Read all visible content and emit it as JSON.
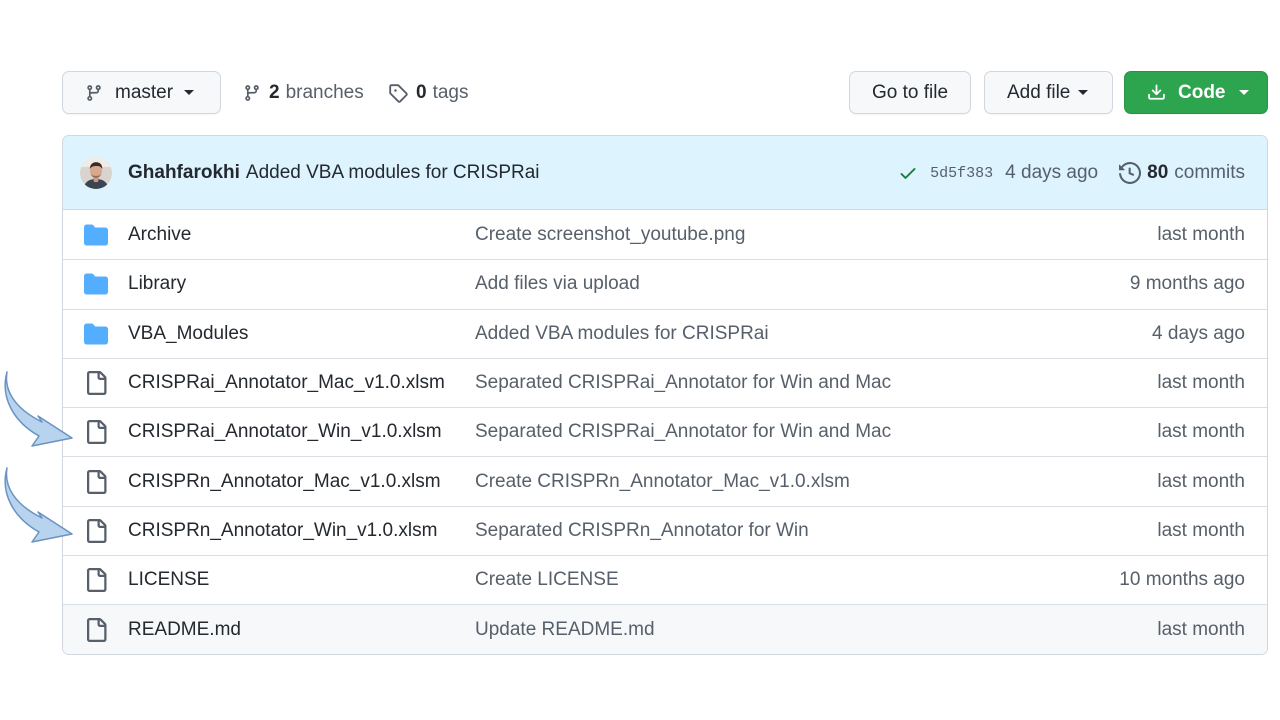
{
  "toolbar": {
    "branch": "master",
    "branches_count": "2",
    "branches_label": "branches",
    "tags_count": "0",
    "tags_label": "tags",
    "go_to_file": "Go to file",
    "add_file": "Add file",
    "code": "Code"
  },
  "commit": {
    "author": "Ghahfarokhi",
    "message": "Added VBA modules for CRISPRai",
    "sha": "5d5f383",
    "time": "4 days ago",
    "commits_count": "80",
    "commits_label": "commits"
  },
  "files": [
    {
      "type": "folder",
      "name": "Archive",
      "message": "Create screenshot_youtube.png",
      "time": "last month"
    },
    {
      "type": "folder",
      "name": "Library",
      "message": "Add files via upload",
      "time": "9 months ago"
    },
    {
      "type": "folder",
      "name": "VBA_Modules",
      "message": "Added VBA modules for CRISPRai",
      "time": "4 days ago"
    },
    {
      "type": "file",
      "name": "CRISPRai_Annotator_Mac_v1.0.xlsm",
      "message": "Separated CRISPRai_Annotator for Win and Mac",
      "time": "last month"
    },
    {
      "type": "file",
      "name": "CRISPRai_Annotator_Win_v1.0.xlsm",
      "message": "Separated CRISPRai_Annotator for Win and Mac",
      "time": "last month"
    },
    {
      "type": "file",
      "name": "CRISPRn_Annotator_Mac_v1.0.xlsm",
      "message": "Create CRISPRn_Annotator_Mac_v1.0.xlsm",
      "time": "last month"
    },
    {
      "type": "file",
      "name": "CRISPRn_Annotator_Win_v1.0.xlsm",
      "message": "Separated CRISPRn_Annotator for Win",
      "time": "last month"
    },
    {
      "type": "file",
      "name": "LICENSE",
      "message": "Create LICENSE",
      "time": "10 months ago"
    },
    {
      "type": "file",
      "name": "README.md",
      "message": "Update README.md",
      "time": "last month"
    }
  ],
  "colors": {
    "accent_green": "#2da44e",
    "folder_blue": "#54aeff",
    "commit_bar_bg": "#ddf4ff",
    "arrow_fill": "#b7d3ee",
    "arrow_stroke": "#6b93c2"
  },
  "icons": {
    "branch": "git-branch-icon",
    "tag": "tag-icon",
    "download": "download-icon",
    "check": "check-icon",
    "history": "history-icon",
    "folder": "folder-icon",
    "file": "file-icon",
    "annotation": "arrow-pointer-icon"
  }
}
